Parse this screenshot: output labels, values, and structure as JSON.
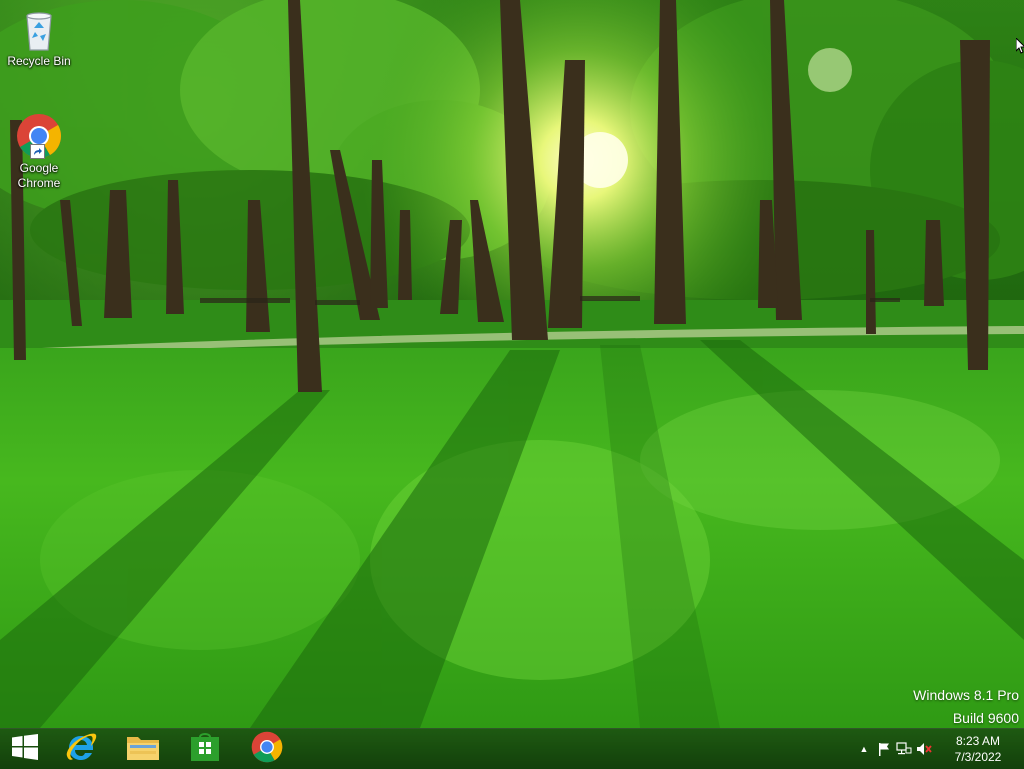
{
  "desktop": {
    "icons": [
      {
        "label": "Recycle Bin",
        "icon": "recycle-bin-icon"
      },
      {
        "label": "Google\nChrome",
        "label_line1": "Google",
        "label_line2": "Chrome",
        "icon": "chrome-icon"
      }
    ],
    "watermark": {
      "line1": "Windows 8.1 Pro",
      "line2": "Build 9600"
    }
  },
  "taskbar": {
    "pinned": [
      {
        "name": "start-button",
        "icon": "windows-logo-icon"
      },
      {
        "name": "internet-explorer",
        "icon": "internet-explorer-icon"
      },
      {
        "name": "file-explorer",
        "icon": "folder-icon"
      },
      {
        "name": "store",
        "icon": "store-icon"
      },
      {
        "name": "google-chrome",
        "icon": "chrome-icon"
      }
    ],
    "tray": {
      "chevron": "▲",
      "icons": [
        "flag-icon",
        "network-icon",
        "speaker-muted-icon"
      ],
      "time": "8:23 AM",
      "date": "7/3/2022"
    }
  },
  "colors": {
    "taskbar": "#1c4f10",
    "chrome_red": "#db4437",
    "chrome_green": "#0f9d58",
    "chrome_yellow": "#f4b400",
    "chrome_blue": "#4285f4",
    "ie_blue": "#1ea1e6",
    "store_green": "#2c9f2c"
  }
}
